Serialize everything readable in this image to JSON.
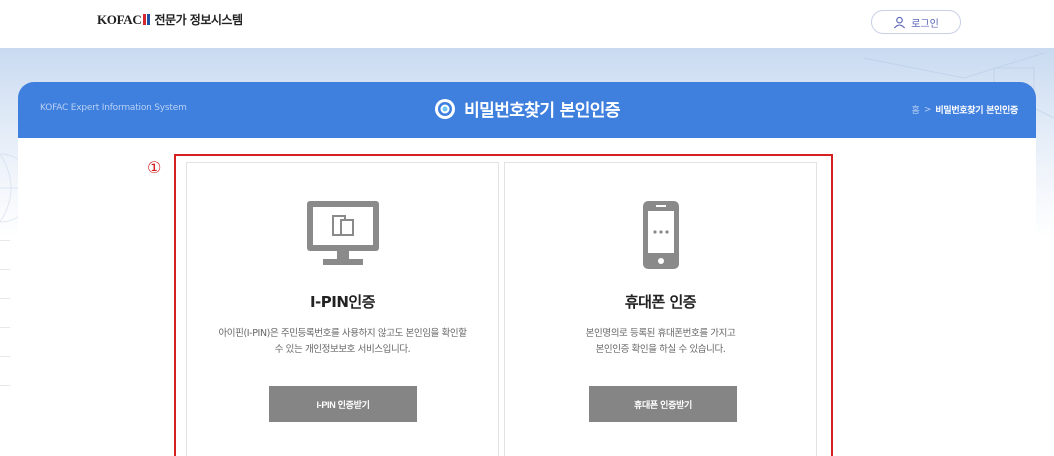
{
  "header": {
    "logo_word": "KOFAC",
    "logo_sub": "전문가 정보시스템",
    "login_label": "로그인",
    "icons": {
      "login": "user-icon"
    },
    "colors": {
      "logo_red": "#d7262f",
      "logo_blue": "#1d4fa3",
      "login_text": "#5a64b8"
    }
  },
  "band": {
    "left_text": "KOFAC Expert Information System",
    "title": "비밀번호찾기 본인인증",
    "title_icon": "target-circle-icon",
    "breadcrumb": {
      "home": "홈",
      "separator": ">",
      "current": "비밀번호찾기 본인인증"
    },
    "colors": {
      "background": "#3f7fdd"
    }
  },
  "annotation": {
    "marker": "①",
    "color": "#d42020"
  },
  "cards": [
    {
      "icon": "monitor-icon",
      "title": "I-PIN인증",
      "desc_line1": "아이핀(I-PIN)은 주민등록번호를 사용하지 않고도 본인임을 확인할",
      "desc_line2": "수 있는 개인정보보호 서비스입니다.",
      "button": "I-PIN 인증받기"
    },
    {
      "icon": "mobile-phone-icon",
      "title": "휴대폰 인증",
      "desc_line1": "본인명의로 등록된 휴대폰번호를 가지고",
      "desc_line2": "본인인증 확인을 하실 수 있습니다.",
      "button": "휴대폰 인증받기"
    }
  ],
  "colors": {
    "button_bg": "#858585",
    "icon_gray": "#8a8a8a"
  }
}
